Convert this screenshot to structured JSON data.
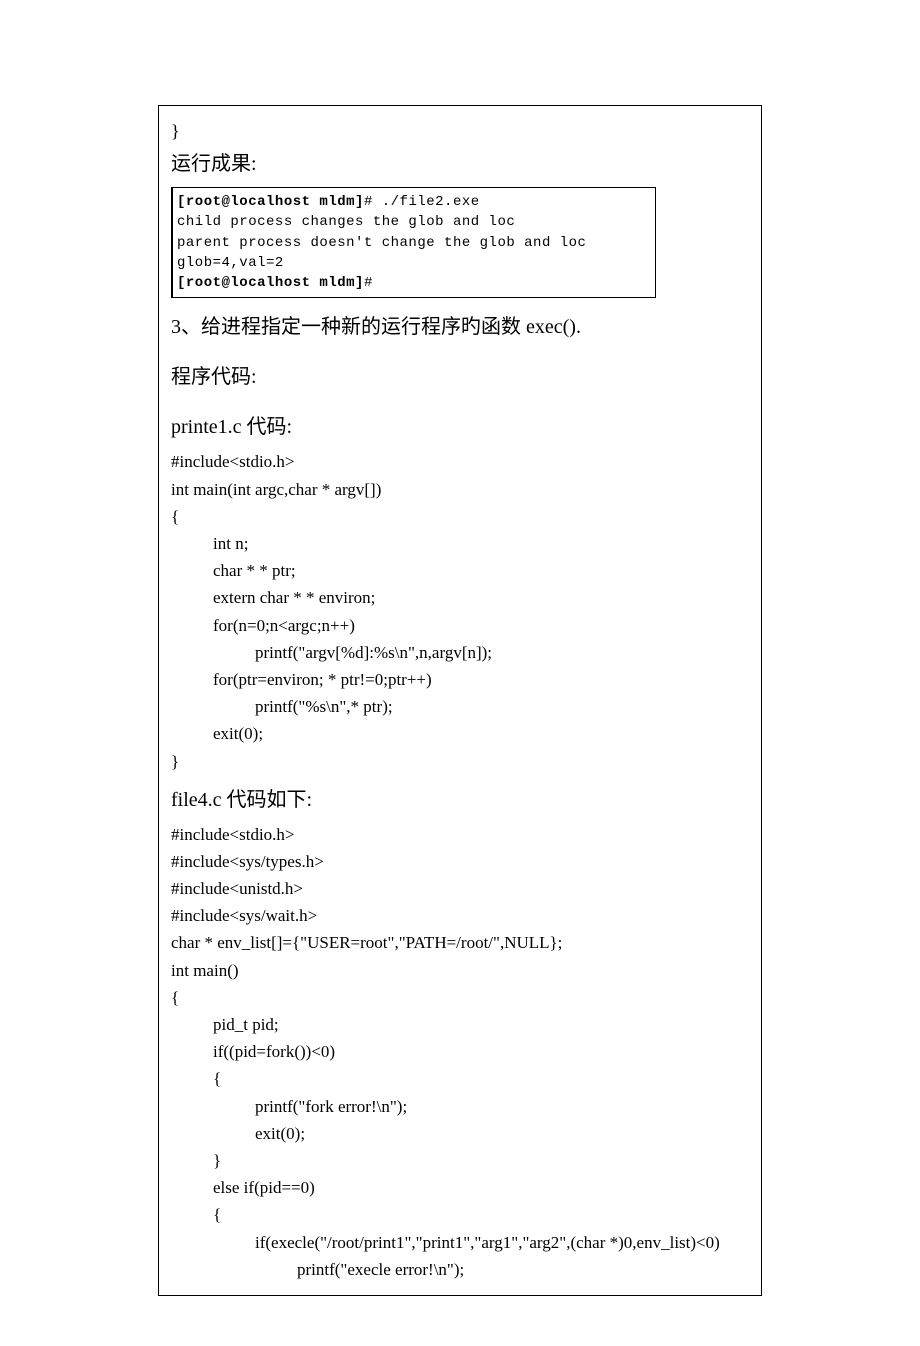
{
  "top": {
    "closing_brace": "}",
    "run_result_label": "运行成果:"
  },
  "terminal": {
    "line1_a": "[root@localhost mldm]",
    "line1_b": "# ./file2.exe",
    "line2": "child process changes the glob and loc",
    "line3": "parent process doesn't change the glob and loc",
    "line4": "glob=4,val=2",
    "line5_a": "[root@localhost mldm]",
    "line5_b": "#"
  },
  "section3": {
    "title": "3、给进程指定一种新的运行程序旳函数 exec().",
    "code_label": "程序代码:"
  },
  "printe1": {
    "heading": "printe1.c 代码:",
    "lines": [
      "#include<stdio.h>",
      "int main(int argc,char * argv[])",
      "{",
      "int n;",
      "char * * ptr;",
      "extern char * * environ;",
      "for(n=0;n<argc;n++)",
      "printf(\"argv[%d]:%s\\n\",n,argv[n]);",
      "for(ptr=environ; * ptr!=0;ptr++)",
      "printf(\"%s\\n\",* ptr);",
      "exit(0);",
      "}"
    ]
  },
  "file4": {
    "heading": "file4.c 代码如下:",
    "lines": [
      "#include<stdio.h>",
      "#include<sys/types.h>",
      "#include<unistd.h>",
      "#include<sys/wait.h>",
      "char * env_list[]={\"USER=root\",\"PATH=/root/\",NULL};",
      "int main()",
      "{",
      "pid_t pid;",
      "if((pid=fork())<0)",
      "{",
      "printf(\"fork error!\\n\");",
      "exit(0);",
      "}",
      "else if(pid==0)",
      "{",
      "if(execle(\"/root/print1\",\"print1\",\"arg1\",\"arg2\",(char *)0,env_list)<0)",
      "printf(\"execle error!\\n\");"
    ]
  }
}
